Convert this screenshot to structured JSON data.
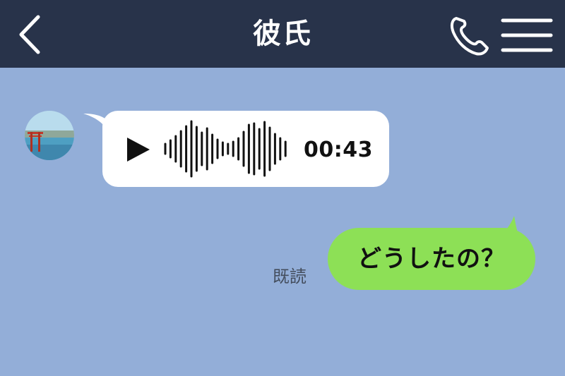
{
  "header": {
    "title": "彼氏",
    "back_icon": "chevron-left-icon",
    "call_icon": "phone-icon",
    "menu_icon": "hamburger-menu-icon"
  },
  "messages": {
    "received_voice": {
      "play_icon": "play-icon",
      "duration": "00:43"
    },
    "sent": {
      "text": "どうしたの？",
      "read_status": "既読"
    }
  },
  "colors": {
    "header_bg": "#28334a",
    "chat_bg": "#93aed8",
    "received_bubble": "#ffffff",
    "sent_bubble": "#8de056"
  }
}
